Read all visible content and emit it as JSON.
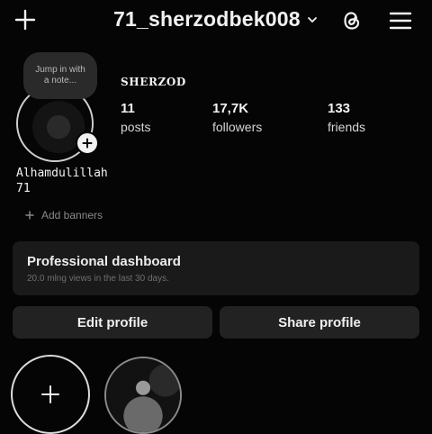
{
  "header": {
    "username": "71_sherzodbek008",
    "icons": [
      "plus-icon",
      "chevron-down-icon",
      "threads-icon",
      "menu-icon"
    ]
  },
  "profile": {
    "note_text": "Jump in with a note...",
    "display_name": "SHERZOD",
    "stats": [
      {
        "value": "11",
        "label": "posts"
      },
      {
        "value": "17,7K",
        "label": "followers"
      },
      {
        "value": "133",
        "label": "friends"
      }
    ],
    "bio": [
      "Alhamdulillah",
      "71"
    ],
    "add_banners": "Add banners"
  },
  "dashboard": {
    "title": "Professional dashboard",
    "subtitle": "20.0 mlng views in the last 30 days."
  },
  "buttons": {
    "edit": "Edit profile",
    "share": "Share profile"
  },
  "colors": {
    "background": "#050505",
    "surface": "#1a1a1a",
    "button": "#222222",
    "text": "#f2f2f2",
    "muted": "#8a8a8a"
  }
}
